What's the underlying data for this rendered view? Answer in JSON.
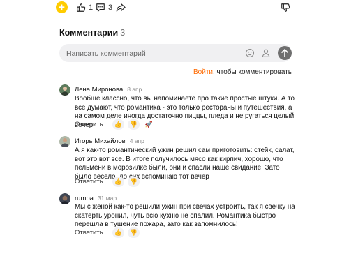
{
  "topbar": {
    "likes": "1",
    "comments": "3"
  },
  "section": {
    "title": "Комментарии",
    "count": "3"
  },
  "input": {
    "placeholder": "Написать комментарий"
  },
  "login": {
    "link": "Войти",
    "text": ", чтобы комментировать"
  },
  "comments": [
    {
      "author": "Лена Миронова",
      "date": "8 апр",
      "text": "Вообще классно, что вы напоминаете про такие простые штуки. А то все думают, что романтика - это только рестораны и путешествия, а на самом деле иногда достаточно пиццы, пледа и не ругаться целый вечер",
      "reply": "Ответить",
      "reactions": [
        "👍",
        "👎",
        "🚀"
      ]
    },
    {
      "author": "Игорь Михайлов",
      "date": "4 апр",
      "text": "А я как-то романтический ужин решил сам приготовить: стейк, салат, вот это вот все. В итоге получилось мясо как кирпич, хорошо, что пельмени в морозилке были, они и спасли наше свидание. Зато было весело, до сих вспоминаю тот вечер",
      "reply": "Ответить",
      "reactions": [
        "👍",
        "👎"
      ],
      "more": "+"
    },
    {
      "author": "rumba",
      "date": "31 мар",
      "text": "Мы с женой как-то решили ужин при свечах устроить, так я свечку на скатерть уронил, чуть всю кухню не спалил. Романтика быстро перешла в тушение пожара, зато как запомнилось!",
      "reply": "Ответить",
      "reactions": [
        "👍",
        "👎"
      ],
      "more": "+"
    }
  ]
}
